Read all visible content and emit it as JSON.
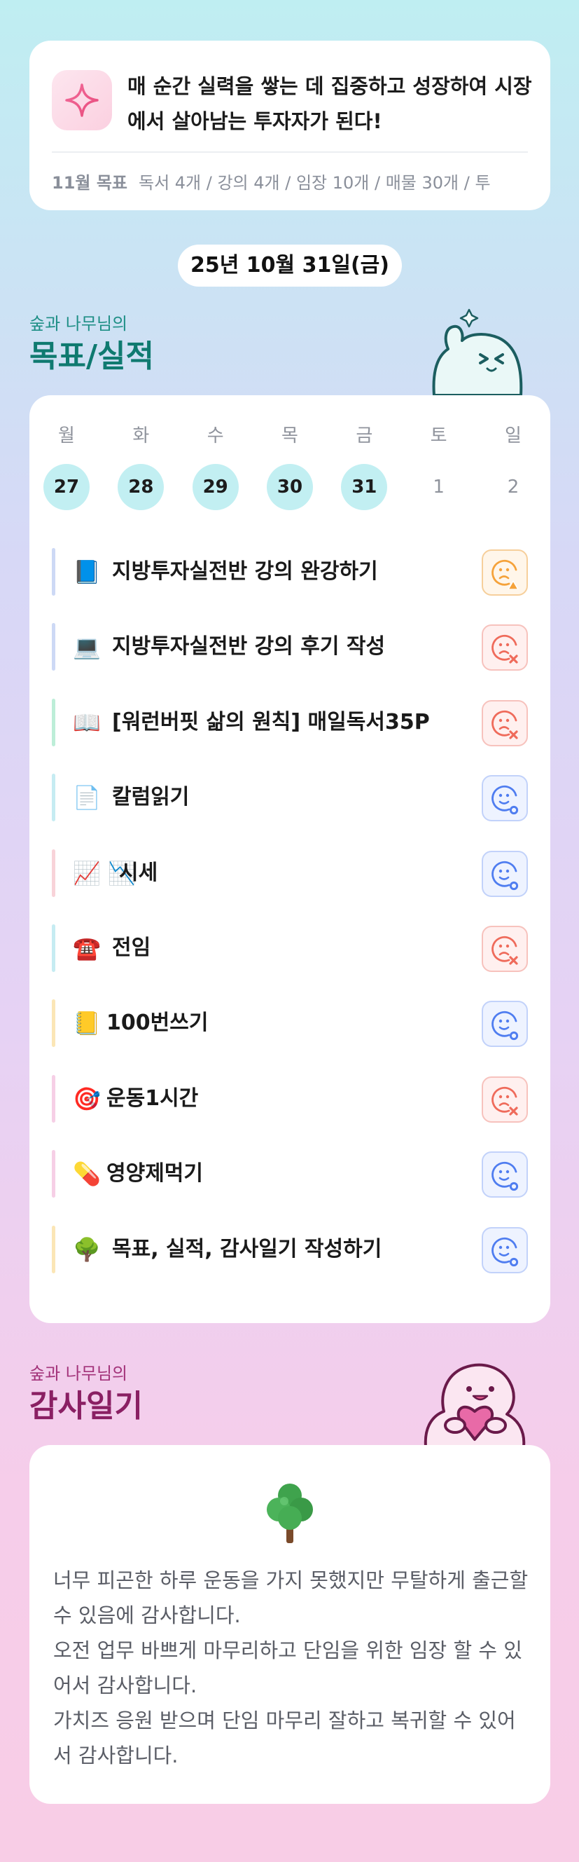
{
  "motto": {
    "icon": "sparkle-icon",
    "text": "매 순간 실력을 쌓는 데 집중하고 성장하여 시장에서 살아남는 투자자가 된다!",
    "goal_label": "11월 목표",
    "goal_text": "독서 4개 / 강의 4개 / 임장 10개 / 매물 30개 / 투"
  },
  "date": "25년 10월 31일(금)",
  "goals_section": {
    "subtitle": "숲과 나무님의",
    "title": "목표/실적"
  },
  "week": [
    {
      "name": "월",
      "date": "27",
      "active": true
    },
    {
      "name": "화",
      "date": "28",
      "active": true
    },
    {
      "name": "수",
      "date": "29",
      "active": true
    },
    {
      "name": "목",
      "date": "30",
      "active": true
    },
    {
      "name": "금",
      "date": "31",
      "active": true
    },
    {
      "name": "토",
      "date": "1",
      "active": false
    },
    {
      "name": "일",
      "date": "2",
      "active": false
    }
  ],
  "tasks": [
    {
      "emoji": "📘",
      "label": "지방투자실전반 강의 완강하기",
      "status": "warn",
      "bar": "#cdd9f5"
    },
    {
      "emoji": "💻",
      "label": "지방투자실전반 강의 후기 작성",
      "status": "fail",
      "bar": "#cdd9f5"
    },
    {
      "emoji": "📖",
      "label": "[워런버핏 삶의 원칙] 매일독서35P",
      "status": "fail",
      "bar": "#bdeed8"
    },
    {
      "emoji": "📄",
      "label": "칼럼읽기",
      "status": "ok",
      "bar": "#c6ecf2"
    },
    {
      "emoji": "📈 📉",
      "label": "시세",
      "status": "ok",
      "bar": "#f8d3d9"
    },
    {
      "emoji": "☎️",
      "label": "전임",
      "status": "fail",
      "bar": "#c6ecf2"
    },
    {
      "emoji": "📒",
      "label": "100번쓰기",
      "status": "ok",
      "bar": "#fbe6b6"
    },
    {
      "emoji": "🎯",
      "label": "운동1시간",
      "status": "fail",
      "bar": "#f6cfe6"
    },
    {
      "emoji": "💊",
      "label": "영양제먹기",
      "status": "ok",
      "bar": "#f6cfe6"
    },
    {
      "emoji": "🌳",
      "label": "목표, 실적, 감사일기 작성하기",
      "status": "ok",
      "bar": "#fbe6b6"
    }
  ],
  "gratitude_section": {
    "subtitle": "숲과 나무님의",
    "title": "감사일기",
    "icon": "tree-icon",
    "text": "너무 피곤한 하루 운동을 가지 못했지만 무탈하게 출근할 수 있음에 감사합니다.\n오전 업무 바쁘게 마무리하고 단임을 위한 임장 할 수 있어서 감사합니다.\n가치즈 응원 받으며 단임 마무리 잘하고 복귀할 수 있어서 감사합니다."
  },
  "colors": {
    "warn": "#f5a23a",
    "fail": "#ef6b5b",
    "ok": "#4f7df0",
    "teal_title": "#0f7a70",
    "magenta_title": "#8a1f63"
  }
}
